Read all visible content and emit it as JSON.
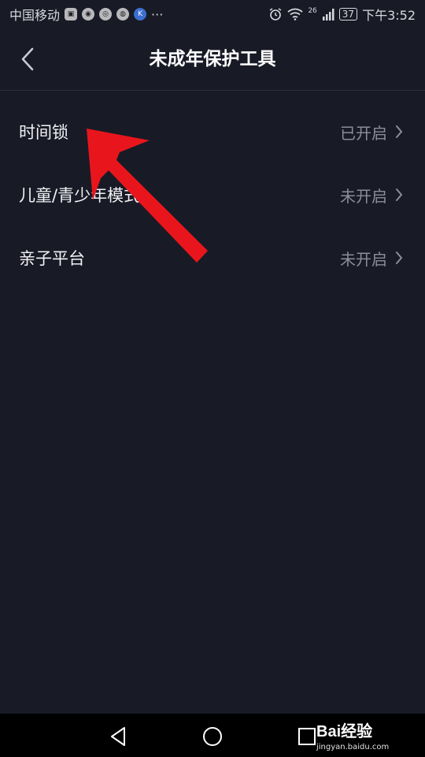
{
  "status_bar": {
    "carrier": "中国移动",
    "more": "···",
    "network": "26",
    "battery": "37",
    "time": "下午3:52",
    "icons": [
      "notification-app-icon",
      "weibo-icon",
      "netease-icon",
      "music-icon",
      "app-icon",
      "alarm-icon",
      "wifi-icon",
      "signal-icon",
      "battery-icon"
    ]
  },
  "header": {
    "title": "未成年保护工具",
    "back_icon": "chevron-left-icon"
  },
  "menu": {
    "items": [
      {
        "label": "时间锁",
        "status": "已开启"
      },
      {
        "label": "儿童/青少年模式",
        "status": "未开启"
      },
      {
        "label": "亲子平台",
        "status": "未开启"
      }
    ]
  },
  "annotation": {
    "arrow_color": "#e8161c"
  },
  "nav_bar": {
    "icons": [
      "back-triangle-icon",
      "home-circle-icon",
      "recents-square-icon"
    ]
  },
  "watermark": {
    "logo": "Bai经验",
    "site": "jingyan.baidu.com"
  },
  "colors": {
    "background": "#181a26",
    "text": "#f2f2f5",
    "status_text": "#8c8d97"
  }
}
